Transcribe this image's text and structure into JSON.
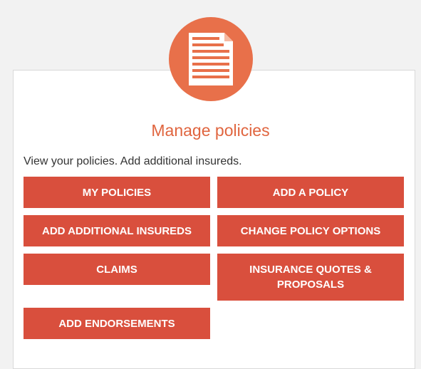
{
  "section": {
    "title": "Manage policies",
    "description": "View your policies. Add additional insureds.",
    "icon": "document-icon",
    "accent_color": "#e8704a",
    "button_color": "#d94f3d"
  },
  "buttons": {
    "my_policies": "MY POLICIES",
    "add_policy": "ADD A POLICY",
    "add_additional_insureds": "ADD ADDITIONAL INSUREDS",
    "change_policy_options": "CHANGE POLICY OPTIONS",
    "claims": "CLAIMS",
    "insurance_quotes": "INSURANCE QUOTES & PROPOSALS",
    "add_endorsements": "ADD ENDORSEMENTS"
  }
}
